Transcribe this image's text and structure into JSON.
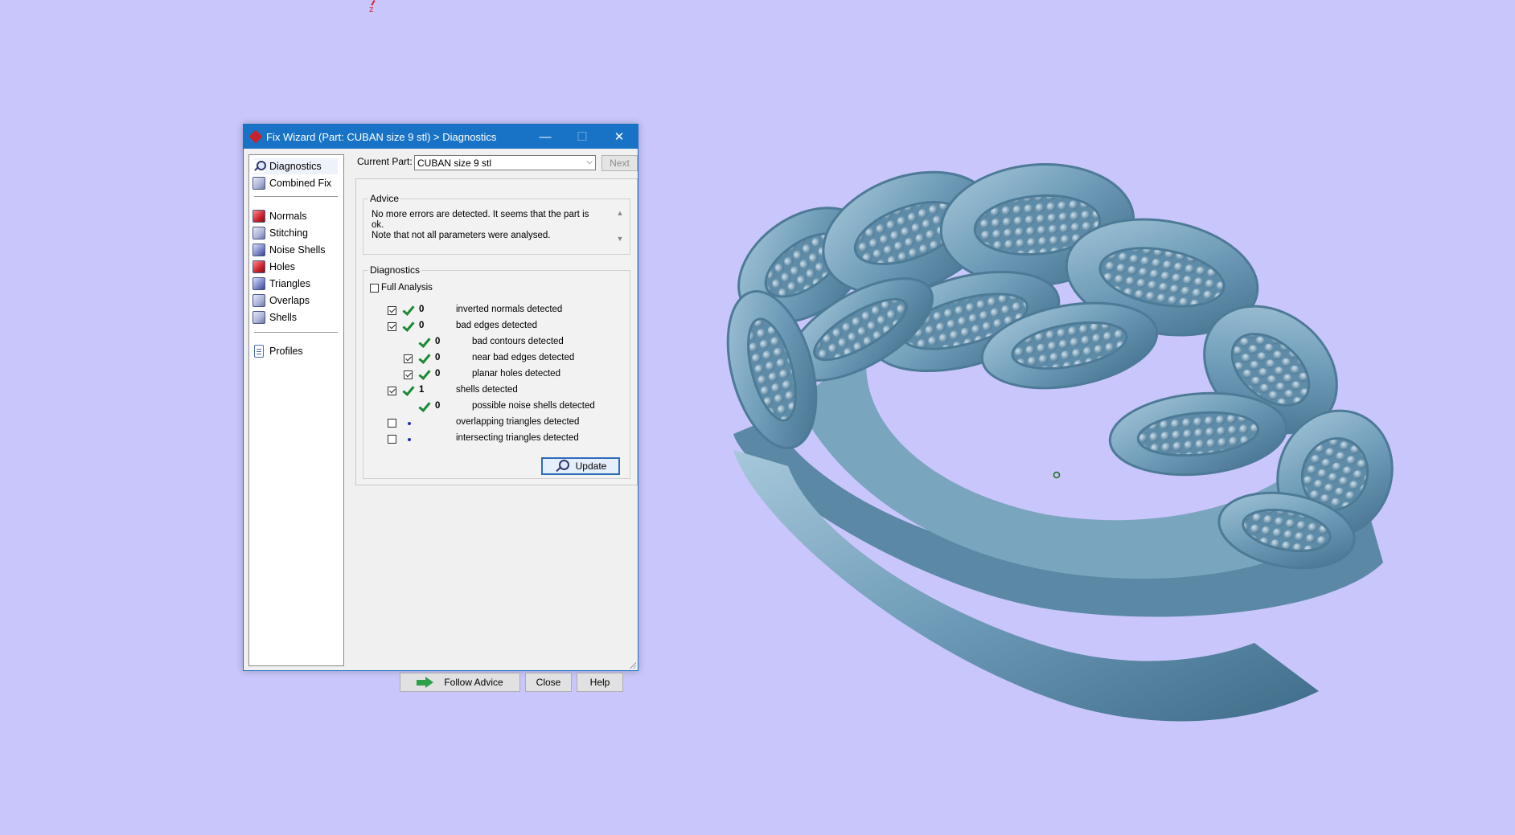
{
  "viewport": {
    "axis_label": "z",
    "background": "#c8c6fa",
    "model_color": "#6d9bb7"
  },
  "dialog": {
    "title": "Fix Wizard (Part: CUBAN size 9 stl) > Diagnostics",
    "controls": {
      "minimize": "—",
      "maximize": "☐",
      "close": "✕"
    },
    "nav": {
      "top": [
        {
          "label": "Diagnostics",
          "icon": "search-icon"
        },
        {
          "label": "Combined Fix",
          "icon": "cube-icon"
        }
      ],
      "fixes": [
        {
          "label": "Normals",
          "icon": "normals-icon"
        },
        {
          "label": "Stitching",
          "icon": "stitching-icon"
        },
        {
          "label": "Noise Shells",
          "icon": "noise-shells-icon"
        },
        {
          "label": "Holes",
          "icon": "holes-icon"
        },
        {
          "label": "Triangles",
          "icon": "triangles-icon"
        },
        {
          "label": "Overlaps",
          "icon": "overlaps-icon"
        },
        {
          "label": "Shells",
          "icon": "shells-icon"
        }
      ],
      "bottom": [
        {
          "label": "Profiles",
          "icon": "profiles-icon"
        }
      ]
    },
    "current_part": {
      "label": "Current Part:",
      "value": "CUBAN size 9 stl"
    },
    "next_label": "Next",
    "advice": {
      "label": "Advice",
      "text_line1": "No more errors are detected. It seems that the part is ok.",
      "text_line2": "Note that not all parameters were analysed."
    },
    "diagnostics": {
      "label": "Diagnostics",
      "full_analysis_label": "Full Analysis",
      "rows": [
        {
          "checked": true,
          "status": "ok",
          "count": "0",
          "label": "inverted normals detected",
          "indent": 0
        },
        {
          "checked": true,
          "status": "ok",
          "count": "0",
          "label": "bad edges detected",
          "indent": 0
        },
        {
          "checked": null,
          "status": "ok",
          "count": "0",
          "label": "bad contours detected",
          "indent": 1
        },
        {
          "checked": true,
          "status": "ok",
          "count": "0",
          "label": "near bad edges detected",
          "indent": 1
        },
        {
          "checked": true,
          "status": "ok",
          "count": "0",
          "label": "planar holes detected",
          "indent": 1
        },
        {
          "checked": true,
          "status": "ok",
          "count": "1",
          "label": "shells detected",
          "indent": 0
        },
        {
          "checked": null,
          "status": "ok",
          "count": "0",
          "label": "possible noise shells detected",
          "indent": 1
        },
        {
          "checked": false,
          "status": "pending",
          "count": "",
          "label": "overlapping triangles detected",
          "indent": 0
        },
        {
          "checked": false,
          "status": "pending",
          "count": "",
          "label": "intersecting triangles detected",
          "indent": 0
        }
      ],
      "update_label": "Update"
    },
    "buttons": {
      "follow_advice": "Follow Advice",
      "close": "Close",
      "help": "Help"
    }
  }
}
